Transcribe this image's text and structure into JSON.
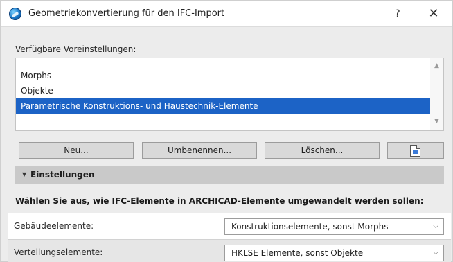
{
  "window": {
    "title": "Geometriekonvertierung für den IFC-Import",
    "help_label": "?",
    "close_label": "✕"
  },
  "presets": {
    "label": "Verfügbare Voreinstellungen:",
    "items": [
      {
        "label": "Morphs",
        "selected": false
      },
      {
        "label": "Objekte",
        "selected": false
      },
      {
        "label": "Parametrische Konstruktions- und Haustechnik-Elemente",
        "selected": true
      }
    ]
  },
  "buttons": {
    "new_label": "Neu...",
    "rename_label": "Umbenennen...",
    "delete_label": "Löschen..."
  },
  "settings": {
    "header": "Einstellungen",
    "instruction": "Wählen Sie aus, wie IFC-Elemente in ARCHICAD-Elemente umgewandelt werden sollen:"
  },
  "rows": [
    {
      "label": "Gebäudeelemente:",
      "value": "Konstruktionselemente, sonst Morphs"
    },
    {
      "label": "Verteilungselemente:",
      "value": "HKLSE Elemente, sonst Objekte"
    }
  ],
  "colors": {
    "selection": "#1c63c6",
    "background": "#ececec",
    "settings_bar": "#c9c9c9"
  },
  "icons": {
    "app": "archicad-globe-icon",
    "export": "document-export-icon"
  }
}
